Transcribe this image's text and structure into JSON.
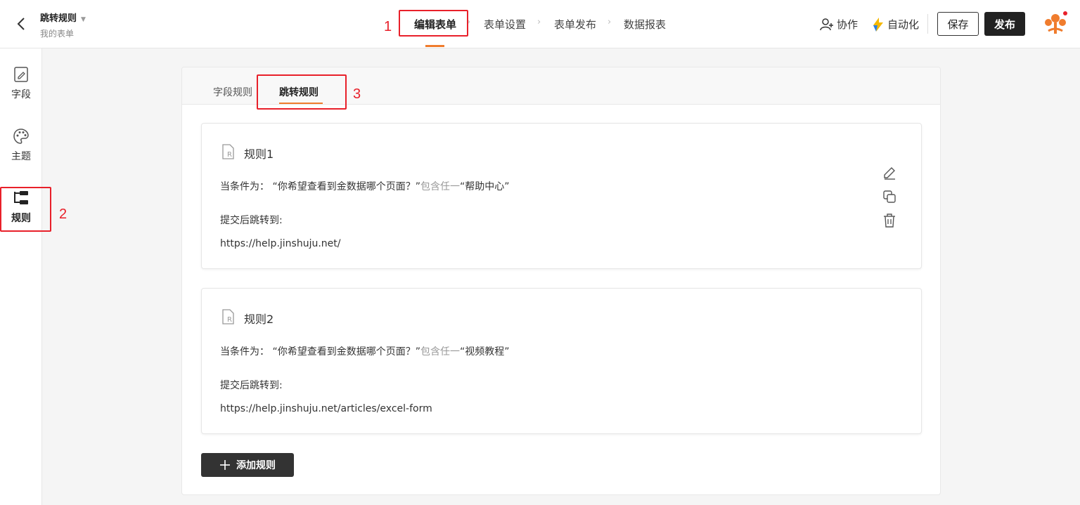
{
  "header": {
    "back_icon": "chevron-left-icon",
    "form_title": "跳转规则",
    "form_subtitle": "我的表单",
    "steps": [
      "编辑表单",
      "表单设置",
      "表单发布",
      "数据报表"
    ],
    "collab_label": "协作",
    "automation_label": "自动化",
    "save_label": "保存",
    "publish_label": "发布",
    "accent_color": "#f07c2d"
  },
  "sidebar": {
    "items": [
      {
        "label": "字段",
        "icon": "field-edit-icon"
      },
      {
        "label": "主题",
        "icon": "palette-icon"
      },
      {
        "label": "规则",
        "icon": "rule-icon"
      }
    ]
  },
  "tabs": [
    "字段规则",
    "跳转规则"
  ],
  "rules": [
    {
      "title": "规则1",
      "cond_prefix": "当条件为：",
      "cond_question": "“你希望查看到金数据哪个页面？”",
      "cond_op": "包含任一",
      "cond_value": "“帮助中心”",
      "jump_label": "提交后跳转到:",
      "url": "https://help.jinshuju.net/"
    },
    {
      "title": "规则2",
      "cond_prefix": "当条件为：",
      "cond_question": "“你希望查看到金数据哪个页面？”",
      "cond_op": "包含任一",
      "cond_value": "“视频教程”",
      "jump_label": "提交后跳转到:",
      "url": "https://help.jinshuju.net/articles/excel-form"
    }
  ],
  "add_rule_label": "添加规则",
  "annotations": [
    "1",
    "2",
    "3"
  ]
}
